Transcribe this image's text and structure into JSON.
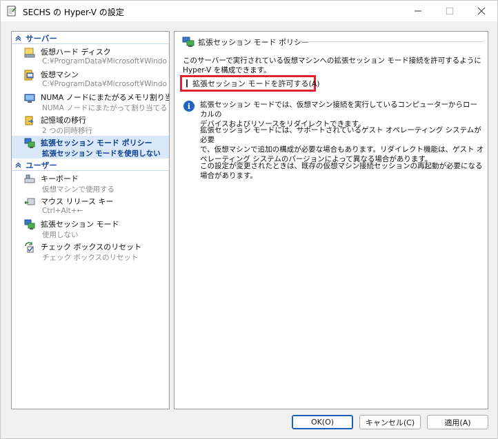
{
  "window": {
    "title": "SECHS の Hyper-V の設定"
  },
  "sidebar": {
    "sections": [
      {
        "label": "サーバー"
      },
      {
        "label": "ユーザー"
      }
    ],
    "server_items": [
      {
        "title": "仮想ハード ディスク",
        "subtitle": "C:¥ProgramData¥Microsoft¥Windo...",
        "icon": "hard-disk-icon"
      },
      {
        "title": "仮想マシン",
        "subtitle": "C:¥ProgramData¥Microsoft¥Windo...",
        "icon": "virtual-machine-icon"
      },
      {
        "title": "NUMA ノードにまたがるメモリ割り当て",
        "subtitle": "NUMA ノードにまたがって割り当てる",
        "icon": "numa-icon"
      },
      {
        "title": "記憶域の移行",
        "subtitle": "2 つの同時移行",
        "icon": "storage-migration-icon"
      },
      {
        "title": "拡張セッション モード ポリシー",
        "subtitle": "拡張セッション モードを使用しない",
        "icon": "enhanced-session-icon"
      }
    ],
    "user_items": [
      {
        "title": "キーボード",
        "subtitle": "仮想マシンで使用する",
        "icon": "keyboard-icon"
      },
      {
        "title": "マウス リリース キー",
        "subtitle": "Ctrl+Alt+←",
        "icon": "mouse-release-icon"
      },
      {
        "title": "拡張セッション モード",
        "subtitle": "使用しない",
        "icon": "enhanced-session-icon"
      },
      {
        "title": "チェック ボックスのリセット",
        "subtitle": "チェック ボックスのリセット",
        "icon": "checkbox-reset-icon"
      }
    ]
  },
  "main": {
    "group_title": "拡張セッション モード ポリシー",
    "description_line1": "このサーバーで実行されている仮想マシンへの拡張セッション モード接続を許可するように",
    "description_line2": "Hyper-V を構成できます。",
    "checkbox_label": "拡張セッション モードを許可する(A)",
    "checkbox_checked": false,
    "info_p1_l1": "拡張セッション モードでは、仮想マシン接続を実行しているコンピューターからローカルの",
    "info_p1_l2": "デバイスおよびリソースをリダイレクトできます。",
    "info_p2_l1": "拡張セッション モードには、サポートされているゲスト オペレーティング システムが必要",
    "info_p2_l2": "で、仮想マシンで追加の構成が必要な場合もあります。リダイレクト機能は、ゲスト オ",
    "info_p2_l3": "ペレーティング システムのバージョンによって異なる場合があります。",
    "info_p3_l1": "この設定が変更されたときは、既存の仮想マシン接続セッションの再起動が必要になる",
    "info_p3_l2": "場合があります。"
  },
  "footer": {
    "ok": "OK(O)",
    "cancel": "キャンセル(C)",
    "apply": "適用(A)"
  },
  "colors": {
    "accent": "#1d4fa8",
    "highlight_border": "#e4212b",
    "selected_bg": "#d9e8f8"
  }
}
